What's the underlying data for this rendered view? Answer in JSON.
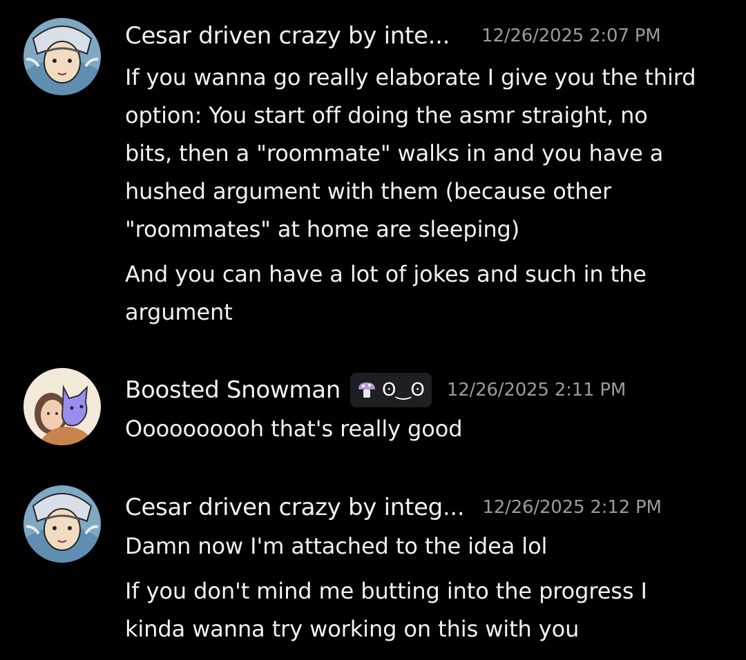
{
  "messages": [
    {
      "author": "Cesar driven crazy by inte...",
      "timestamp": "12/26/2025 2:07 PM",
      "lines": [
        "If you wanna go really elaborate I give you the third",
        "option: You start off doing the asmr straight, no",
        "bits, then a \"roommate\" walks in and you have a",
        "hushed argument with them (because other",
        "\"roommates\" at home are sleeping)",
        "And you can have a lot of jokes and such in the",
        "argument"
      ]
    },
    {
      "author": "Boosted Snowman",
      "tag_icon": "mushroom-icon",
      "tag_text": "ʘ‿ʘ",
      "timestamp": "12/26/2025 2:11 PM",
      "lines": [
        "Oooooooooh that's really good"
      ]
    },
    {
      "author": "Cesar driven crazy by integ...",
      "timestamp": "12/26/2025 2:12 PM",
      "lines": [
        "Damn now I'm attached to the idea lol",
        "If you don't mind me butting into the progress I",
        "kinda wanna try working on this with you"
      ]
    }
  ],
  "colors": {
    "background": "#000000",
    "text": "#f2f3f5",
    "timestamp": "#9b9ba2",
    "tag_background": "#1e1f22"
  }
}
